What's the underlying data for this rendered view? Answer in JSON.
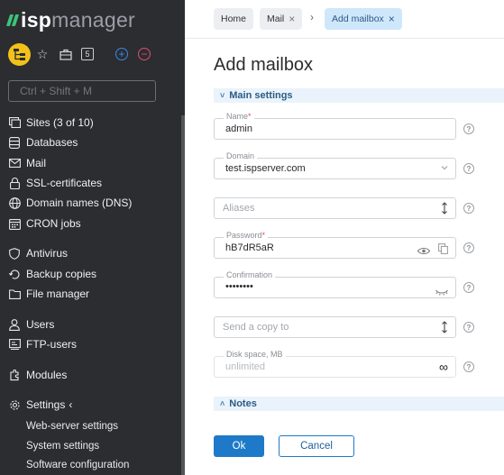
{
  "brand": {
    "part1": "isp",
    "part2": "manager"
  },
  "quick": {
    "five_label": "5"
  },
  "search": {
    "placeholder": "Ctrl + Shift + M"
  },
  "nav": {
    "sites": "Sites (3 of 10)",
    "databases": "Databases",
    "mail": "Mail",
    "ssl": "SSL-certificates",
    "dns": "Domain names (DNS)",
    "cron": "CRON jobs",
    "antivirus": "Antivirus",
    "backup": "Backup copies",
    "files": "File manager",
    "users": "Users",
    "ftp": "FTP-users",
    "modules": "Modules",
    "settings": "Settings",
    "settings_arrow": "‹",
    "settings_sub": [
      "Web-server settings",
      "System settings",
      "Software configuration"
    ]
  },
  "breadcrumb": {
    "home": "Home",
    "mail": "Mail",
    "separator": "›",
    "current": "Add mailbox",
    "close": "×"
  },
  "page": {
    "title": "Add mailbox"
  },
  "sections": {
    "main": "Main settings",
    "notes": "Notes",
    "main_chevron": "˅",
    "notes_chevron": "˄"
  },
  "form": {
    "name": {
      "label": "Name",
      "required_mark": "*",
      "value": "admin"
    },
    "domain": {
      "label": "Domain",
      "value": "test.ispserver.com"
    },
    "aliases": {
      "placeholder": "Aliases"
    },
    "password": {
      "label": "Password",
      "required_mark": "*",
      "value": "hB7dR5aR"
    },
    "confirmation": {
      "label": "Confirmation",
      "value": "••••••••"
    },
    "send_copy": {
      "placeholder": "Send a copy to"
    },
    "disk_space": {
      "label": "Disk space, MB",
      "value": "unlimited",
      "infinity": "∞"
    },
    "help_mark": "?"
  },
  "buttons": {
    "ok": "Ok",
    "cancel": "Cancel"
  },
  "colors": {
    "sidebar_bg": "#2b2d31",
    "accent": "#1e7ac8",
    "brand_green": "#3fc37a",
    "required": "#e24e6c"
  }
}
